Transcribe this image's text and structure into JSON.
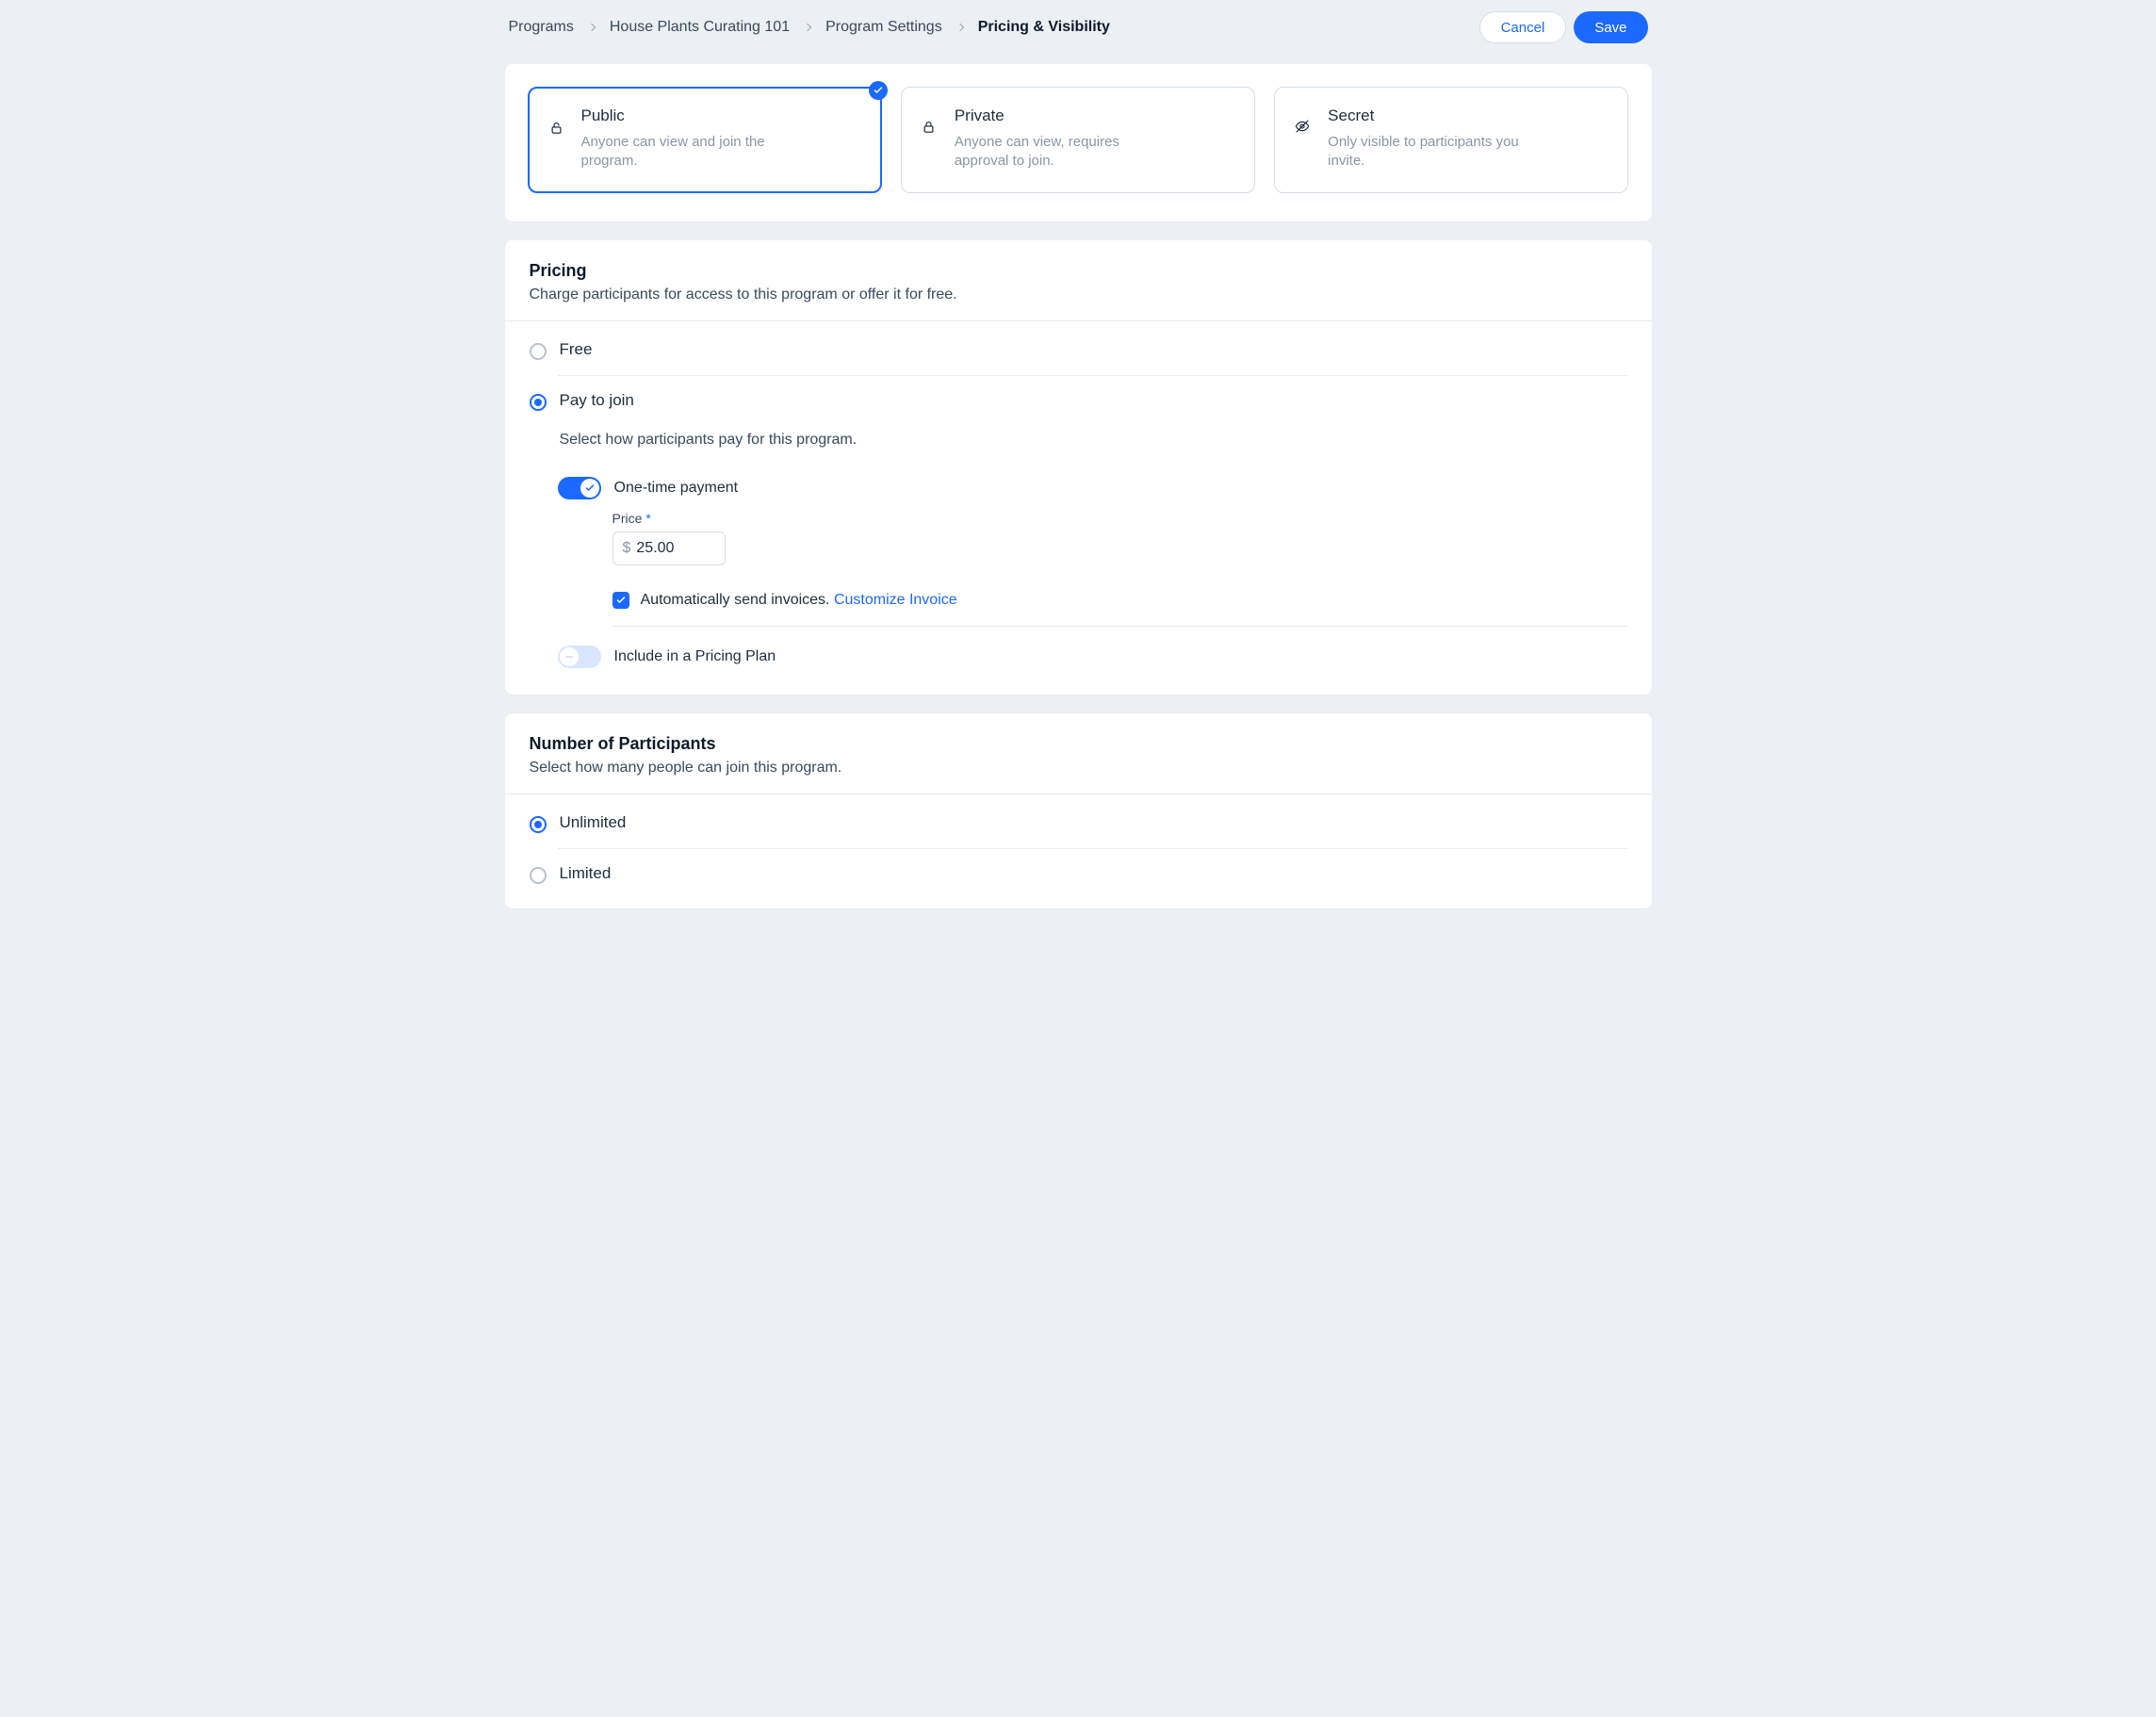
{
  "breadcrumbs": {
    "items": [
      "Programs",
      "House Plants Curating 101",
      "Program Settings",
      "Pricing & Visibility"
    ],
    "active_index": 3
  },
  "actions": {
    "cancel": "Cancel",
    "save": "Save"
  },
  "visibility": {
    "options": [
      {
        "title": "Public",
        "desc": "Anyone can view and join the program.",
        "selected": true
      },
      {
        "title": "Private",
        "desc": "Anyone can view, requires approval to join.",
        "selected": false
      },
      {
        "title": "Secret",
        "desc": "Only visible to participants you invite.",
        "selected": false
      }
    ]
  },
  "pricing": {
    "heading": "Pricing",
    "subheading": "Charge participants for access to this program or offer it for free.",
    "options": {
      "free": {
        "label": "Free",
        "selected": false
      },
      "pay": {
        "label": "Pay to join",
        "subtitle": "Select how participants pay for this program.",
        "selected": true
      }
    },
    "one_time": {
      "enabled": true,
      "label": "One-time payment",
      "price_label": "Price",
      "currency": "$",
      "price_value": "25.00"
    },
    "invoice": {
      "checked": true,
      "text": "Automatically send invoices.",
      "link": "Customize Invoice"
    },
    "plan_toggle": {
      "enabled": false,
      "label": "Include in a Pricing Plan"
    }
  },
  "participants": {
    "heading": "Number of Participants",
    "subheading": "Select how many people can join this program.",
    "options": {
      "unlimited": {
        "label": "Unlimited",
        "selected": true
      },
      "limited": {
        "label": "Limited",
        "selected": false
      }
    }
  }
}
